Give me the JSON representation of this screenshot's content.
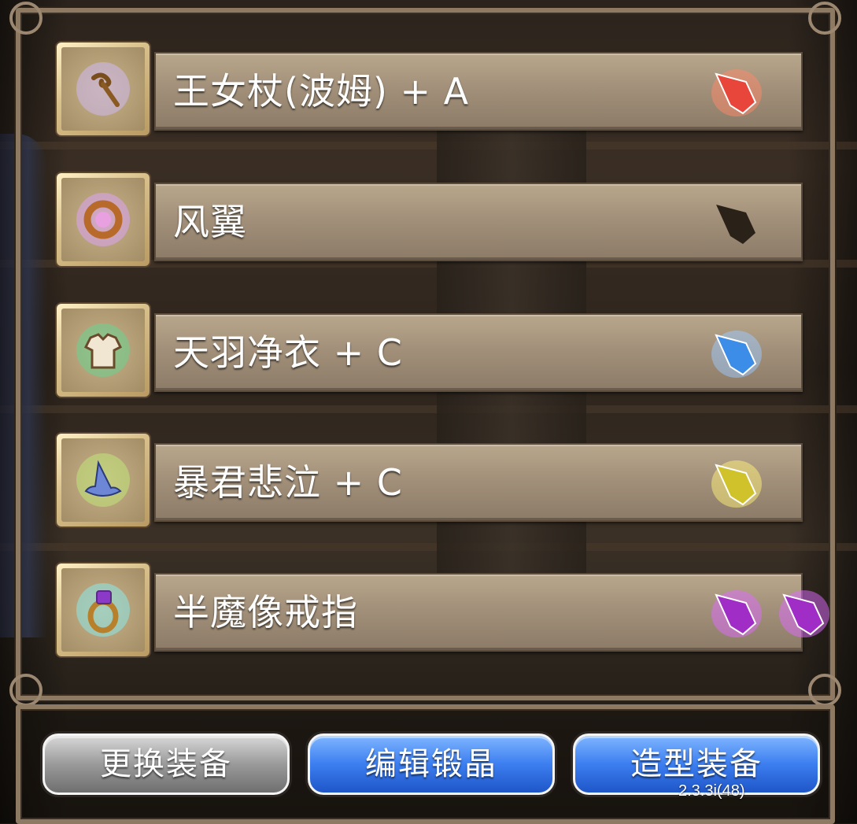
{
  "equipment": [
    {
      "name": "王女杖(波姆) + A",
      "icon": "staff-icon",
      "icon_glow": "#cbb7e6",
      "gems": [
        {
          "color": "#e8463a",
          "glow": "#ff8a6a",
          "icon": "red-crystal-icon"
        }
      ]
    },
    {
      "name": "风翼",
      "icon": "ring-icon",
      "icon_glow": "#d9a4e8",
      "gems": [
        {
          "color": "#2a2219",
          "glow": "#000000",
          "icon": "empty-crystal-slot-icon"
        }
      ]
    },
    {
      "name": "天羽净衣 + C",
      "icon": "robe-icon",
      "icon_glow": "#6fcf8d",
      "gems": [
        {
          "color": "#3c8de8",
          "glow": "#9cc9ff",
          "icon": "blue-crystal-icon"
        }
      ]
    },
    {
      "name": "暴君悲泣 + C",
      "icon": "wizard-hat-icon",
      "icon_glow": "#bfe07a",
      "gems": [
        {
          "color": "#cfc22a",
          "glow": "#fff27a",
          "icon": "yellow-crystal-icon"
        }
      ]
    },
    {
      "name": "半魔像戒指",
      "icon": "gem-ring-icon",
      "icon_glow": "#8fe1e0",
      "gems": [
        {
          "color": "#a12dc7",
          "glow": "#e06cff",
          "icon": "purple-crystal-icon"
        },
        {
          "color": "#a12dc7",
          "glow": "#e06cff",
          "icon": "purple-crystal-icon"
        }
      ]
    }
  ],
  "buttons": {
    "change_equipment": "更换装备",
    "edit_crystals": "编辑锻晶",
    "appearance_equipment": "造型装备"
  },
  "version": "2.3.3i(48)"
}
